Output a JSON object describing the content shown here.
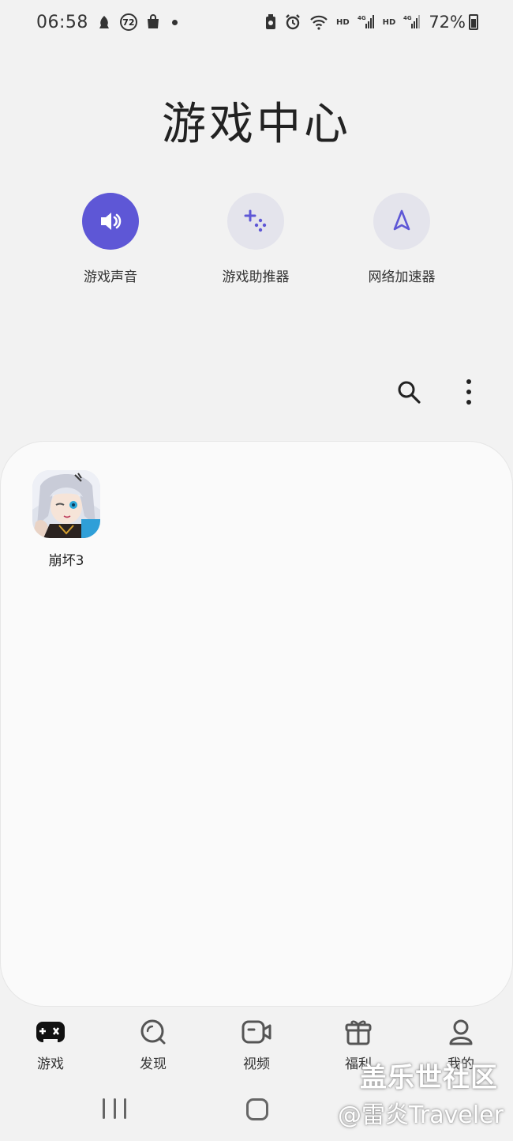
{
  "status_bar": {
    "time": "06:58",
    "badge_number": "72",
    "hd_1": "HD",
    "hd_2": "HD",
    "net_1": "4G",
    "net_2": "4G",
    "battery_percent": "72%"
  },
  "header": {
    "title": "游戏中心"
  },
  "quick_actions": [
    {
      "label": "游戏声音",
      "icon": "speaker-icon",
      "active": true
    },
    {
      "label": "游戏助推器",
      "icon": "game-booster-icon",
      "active": false
    },
    {
      "label": "网络加速器",
      "icon": "rocket-icon",
      "active": false
    }
  ],
  "toolbar": {
    "search_icon": "search-icon",
    "more_icon": "more-vert-icon"
  },
  "games": [
    {
      "label": "崩坏3"
    }
  ],
  "bottom_nav": [
    {
      "label": "游戏",
      "icon": "gamepad-icon",
      "selected": true
    },
    {
      "label": "发现",
      "icon": "discover-icon",
      "selected": false
    },
    {
      "label": "视频",
      "icon": "video-icon",
      "selected": false
    },
    {
      "label": "福利",
      "icon": "gift-icon",
      "selected": false
    },
    {
      "label": "我的",
      "icon": "profile-icon",
      "selected": false
    }
  ],
  "watermark": {
    "line1": "盖乐世社区",
    "line2": "@雷炎Traveler"
  },
  "colors": {
    "accent": "#5e57d6",
    "background": "#f2f2f2",
    "card": "#fafafa"
  }
}
